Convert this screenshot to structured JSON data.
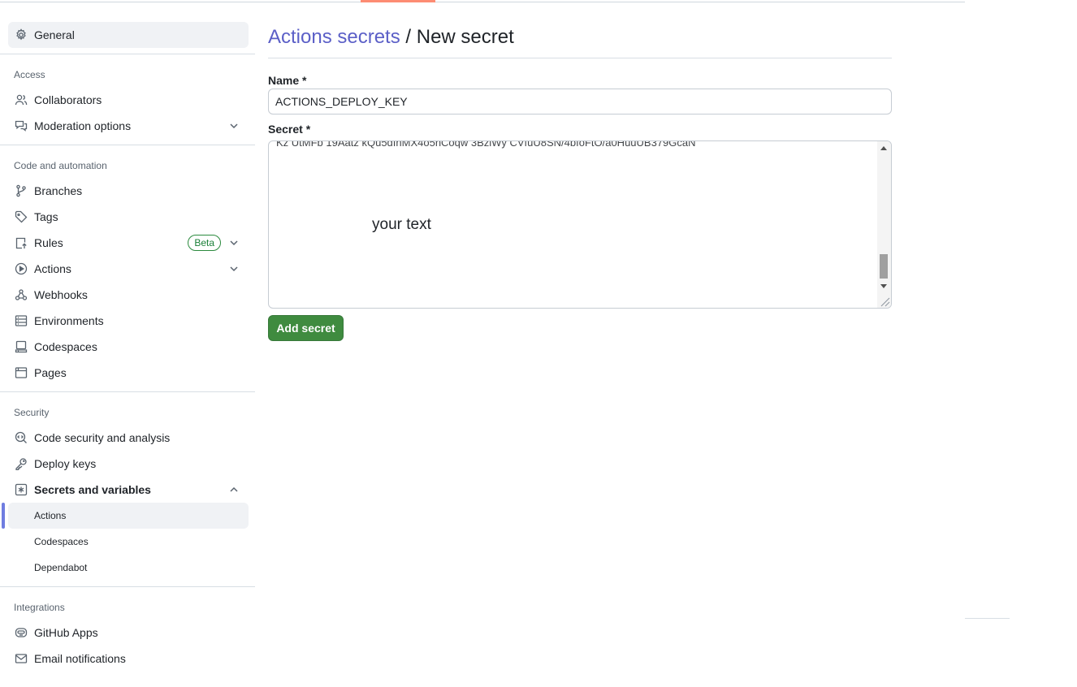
{
  "sidebar": {
    "general": "General",
    "groups": {
      "access": "Access",
      "code_automation": "Code and automation",
      "security": "Security",
      "integrations": "Integrations"
    },
    "items": {
      "collaborators": "Collaborators",
      "moderation": "Moderation options",
      "branches": "Branches",
      "tags": "Tags",
      "rules": "Rules",
      "rules_badge": "Beta",
      "actions": "Actions",
      "webhooks": "Webhooks",
      "environments": "Environments",
      "codespaces": "Codespaces",
      "pages": "Pages",
      "code_security": "Code security and analysis",
      "deploy_keys": "Deploy keys",
      "secrets_variables": "Secrets and variables",
      "github_apps": "GitHub Apps",
      "email_notifications": "Email notifications"
    },
    "sub_items": {
      "actions": "Actions",
      "codespaces": "Codespaces",
      "dependabot": "Dependabot"
    }
  },
  "main": {
    "breadcrumb_link": "Actions secrets",
    "breadcrumb_sep": " / ",
    "title": "New secret",
    "name_label": "Name *",
    "name_value": "ACTIONS_DEPLOY_KEY",
    "secret_label": "Secret *",
    "secret_cut_line": "Kz UtMFb 19Aatz kQu5dIhMX4o5nCoqw 3BziWy CVfuU8SN/4bfoFtO/a0HuuUB379GcaN",
    "secret_text": "your text",
    "add_button": "Add secret"
  },
  "colors": {
    "link": "#5b5fc7",
    "button": "#3f8b3f",
    "selection_bar": "#6f7de0",
    "badge": "#1a7f37"
  }
}
